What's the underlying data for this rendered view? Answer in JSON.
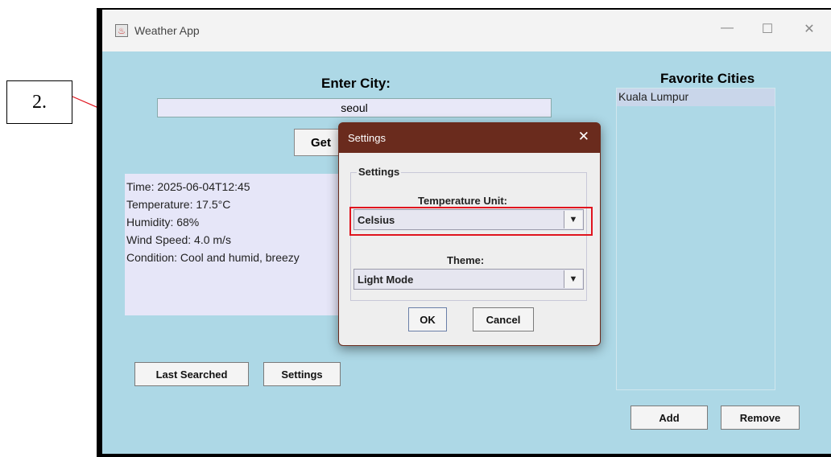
{
  "annotation": {
    "label": "2."
  },
  "window": {
    "title": "Weather App",
    "controls": {
      "minimize": "—",
      "maximize": "☐",
      "close": "✕"
    }
  },
  "main": {
    "enter_city_label": "Enter City:",
    "city_value": "seoul",
    "get_button": "Get",
    "weather_lines": [
      "Time: 2025-06-04T12:45",
      "Temperature: 17.5°C",
      "Humidity: 68%",
      "Wind Speed: 4.0 m/s",
      "Condition: Cool and humid, breezy"
    ],
    "last_searched_button": "Last Searched",
    "settings_button": "Settings"
  },
  "favorites": {
    "title": "Favorite Cities",
    "items": [
      "Kuala Lumpur"
    ],
    "add_button": "Add",
    "remove_button": "Remove"
  },
  "dialog": {
    "title": "Settings",
    "close": "✕",
    "group_label": "Settings",
    "temp_unit_label": "Temperature Unit:",
    "temp_unit_value": "Celsius",
    "theme_label": "Theme:",
    "theme_value": "Light Mode",
    "ok_button": "OK",
    "cancel_button": "Cancel"
  },
  "colors": {
    "client_bg": "#add8e6",
    "dialog_titlebar": "#6a2b1d",
    "highlight": "#e0141e"
  }
}
